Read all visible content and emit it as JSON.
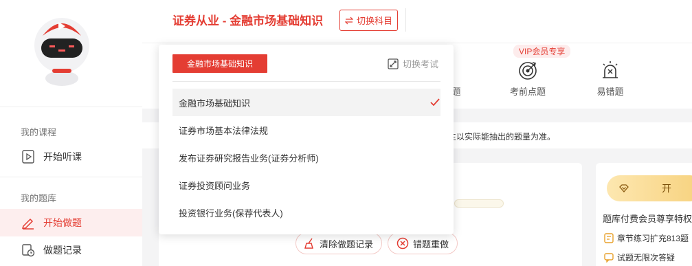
{
  "sidebar": {
    "sections": [
      {
        "heading": "我的课程",
        "items": [
          {
            "label": "开始听课"
          }
        ]
      },
      {
        "heading": "我的题库",
        "items": [
          {
            "label": "开始做题"
          },
          {
            "label": "做题记录"
          }
        ]
      }
    ]
  },
  "header": {
    "title": "证券从业 - 金融市场基础知识",
    "switch_label": "切换科目"
  },
  "functions": [
    {
      "label": "题",
      "icon": "question-icon"
    },
    {
      "label": "考前点题",
      "icon": "target-icon"
    },
    {
      "label": "易错题",
      "icon": "alarm-icon"
    }
  ],
  "vip_badge": "VIP会员专享",
  "notice": "生以实际能抽出的题量为准。",
  "actions": {
    "clear_label": "清除做题记录",
    "redo_label": "错题重做"
  },
  "vip_card": {
    "open_label": "开",
    "title": "题库付费会员尊享特权",
    "features": [
      "章节练习扩充813题",
      "试题无限次答疑"
    ]
  },
  "dropdown": {
    "active_label": "金融市场基础知识",
    "switch_exam_label": "切换考试",
    "items": [
      {
        "label": "金融市场基础知识",
        "selected": true
      },
      {
        "label": "证券市场基本法律法规"
      },
      {
        "label": "发布证券研究报告业务(证券分析师)"
      },
      {
        "label": "证券投资顾问业务"
      },
      {
        "label": "投资银行业务(保荐代表人)"
      }
    ]
  },
  "colors": {
    "accent": "#e43d33",
    "active_bg": "#fdeeee",
    "vip_gold": "#f7d27e"
  }
}
